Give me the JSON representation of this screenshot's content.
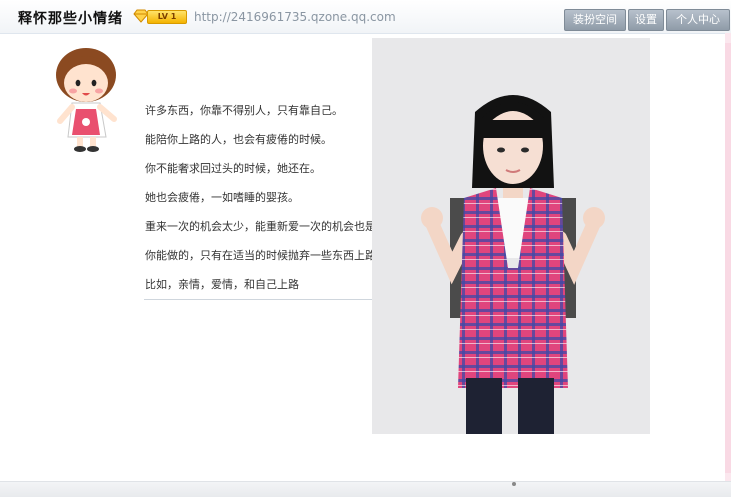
{
  "header": {
    "title": "释怀那些小情绪",
    "level_badge": "LV 1",
    "url": "http://2416961735.qzone.qq.com",
    "buttons": {
      "dress_space": "装扮空间",
      "settings": "设置",
      "personal_center": "个人中心"
    }
  },
  "content": {
    "lines": [
      "  许多东西，你靠不得别人，只有靠自己。",
      "能陪你上路的人，也会有疲倦的时候。",
      "你不能奢求回过头的时候，她还在。",
      "她也会疲倦，一如嗜睡的婴孩。",
      "重来一次的机会太少，能重新爱一次的机会也是。",
      "你能做的，只有在适当的时候抛弃一些东西上路。",
      "比如，亲情，爱情，和自己上路"
    ]
  },
  "colors": {
    "accent_button": "#9aa6b2",
    "badge_gold": "#f4b300",
    "scroll_pink": "#fbe7ee"
  },
  "icons": [
    "diamond-icon",
    "mascot-girl-icon",
    "photo-image"
  ]
}
